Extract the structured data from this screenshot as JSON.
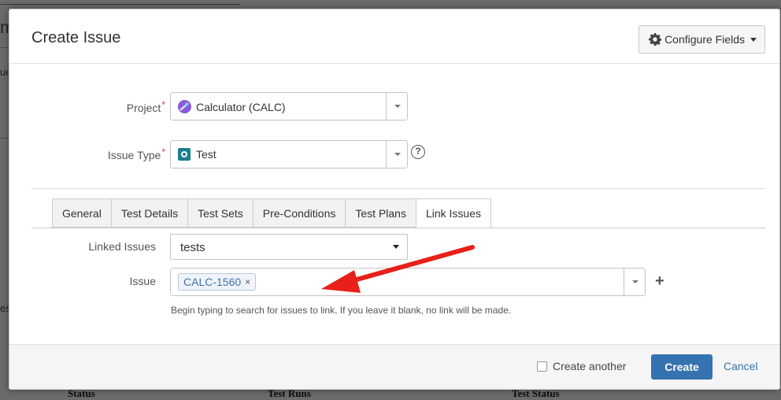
{
  "background": {
    "heading_fragment": "m",
    "side_fragment": "ue",
    "side_fragment_2": "es",
    "bottom_columns": [
      "Status",
      "Test Runs",
      "Test Status"
    ]
  },
  "dialog": {
    "title": "Create Issue",
    "configure_fields_label": "Configure Fields",
    "project": {
      "label": "Project",
      "required_mark": "*",
      "value": "Calculator (CALC)"
    },
    "issue_type": {
      "label": "Issue Type",
      "required_mark": "*",
      "value": "Test",
      "help_glyph": "?"
    },
    "tabs": [
      {
        "label": "General",
        "active": false
      },
      {
        "label": "Test Details",
        "active": false
      },
      {
        "label": "Test Sets",
        "active": false
      },
      {
        "label": "Pre-Conditions",
        "active": false
      },
      {
        "label": "Test Plans",
        "active": false
      },
      {
        "label": "Link Issues",
        "active": true
      }
    ],
    "linked_issues": {
      "label": "Linked Issues",
      "value": "tests"
    },
    "issue": {
      "label": "Issue",
      "chip": "CALC-1560",
      "chip_remove": "×",
      "add_glyph": "+",
      "hint": "Begin typing to search for issues to link. If you leave it blank, no link will be made."
    },
    "footer": {
      "create_another_label": "Create another",
      "create_another_checked": false,
      "create_label": "Create",
      "cancel_label": "Cancel"
    }
  },
  "colors": {
    "primary": "#3572b0",
    "link": "#3b73af",
    "required": "#d04437",
    "annotation_arrow": "#e8201a",
    "project_icon": "#8a5ad8",
    "test_icon": "#1b7f8c"
  },
  "icons": [
    "gear-icon",
    "project-avatar-icon",
    "test-issue-type-icon",
    "help-icon",
    "plus-icon",
    "red-annotation-arrow"
  ]
}
